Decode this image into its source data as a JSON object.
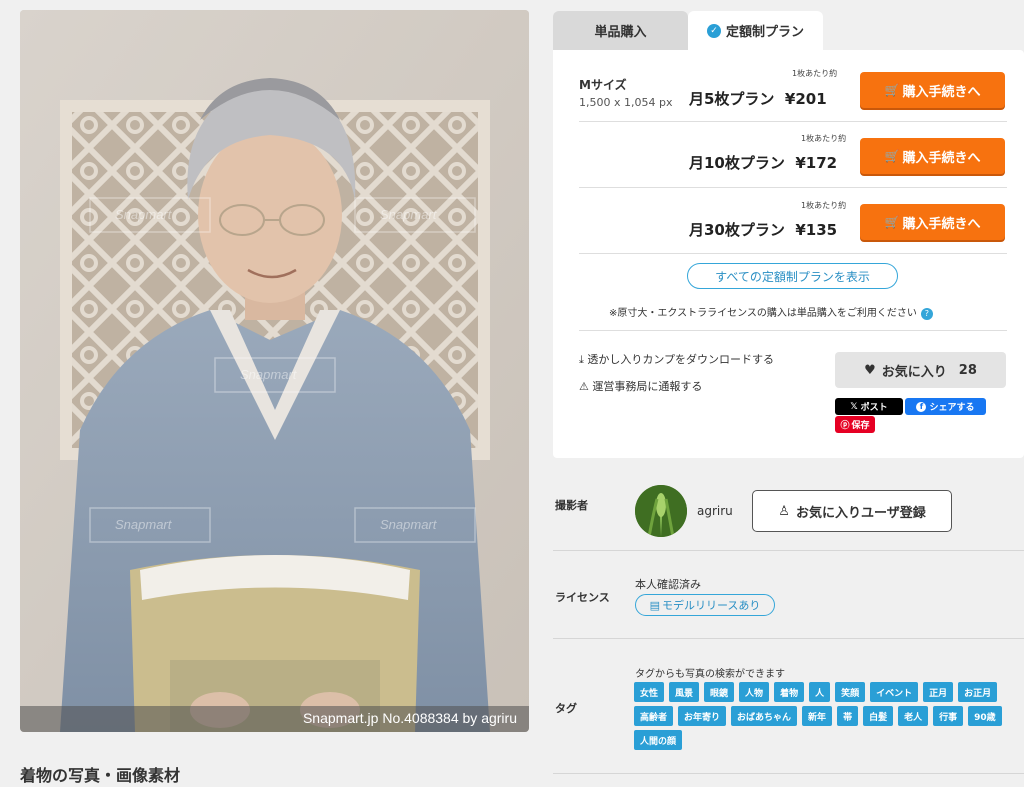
{
  "photo": {
    "watermark": "Snapmart",
    "caption": "Snapmart.jp No.4088384 by agriru"
  },
  "page_heading": "着物の写真・画像素材",
  "tabs": [
    {
      "label": "単品購入",
      "active": false
    },
    {
      "label": "定額制プラン",
      "active": true
    }
  ],
  "purchase": {
    "size_label": "Mサイズ",
    "size_px": "1,500 x 1,054 px",
    "per_sheet_label": "1枚あたり約",
    "buy_label": "購入手続きへ",
    "plans": [
      {
        "name": "月5枚プラン",
        "price": "¥201"
      },
      {
        "name": "月10枚プラン",
        "price": "¥172"
      },
      {
        "name": "月30枚プラン",
        "price": "¥135"
      }
    ],
    "all_plans_label": "すべての定額制プランを表示",
    "note": "※原寸大・エクストラライセンスの購入は単品購入をご利用ください",
    "download_comp": "透かし入りカンプをダウンロードする",
    "report": "運営事務局に通報する",
    "favorite_label": "お気に入り",
    "favorite_count": "28",
    "x_post": "ポスト",
    "fb_share": "シェアする",
    "pin_save": "保存"
  },
  "photographer_section": {
    "label": "撮影者",
    "name": "agriru",
    "follow_label": "お気に入りユーザ登録"
  },
  "license_section": {
    "label": "ライセンス",
    "verified": "本人確認済み",
    "model_release": "モデルリリースあり"
  },
  "tag_section": {
    "label": "タグ",
    "hint": "タグからも写真の検索ができます",
    "tags": [
      "女性",
      "風景",
      "眼鏡",
      "人物",
      "着物",
      "人",
      "笑顔",
      "イベント",
      "正月",
      "お正月",
      "高齢者",
      "お年寄り",
      "おばあちゃん",
      "新年",
      "帯",
      "白髪",
      "老人",
      "行事",
      "90歳",
      "人間の顔"
    ]
  },
  "colors": {
    "accent_orange": "#f7720f",
    "accent_blue": "#2a9fd6"
  }
}
